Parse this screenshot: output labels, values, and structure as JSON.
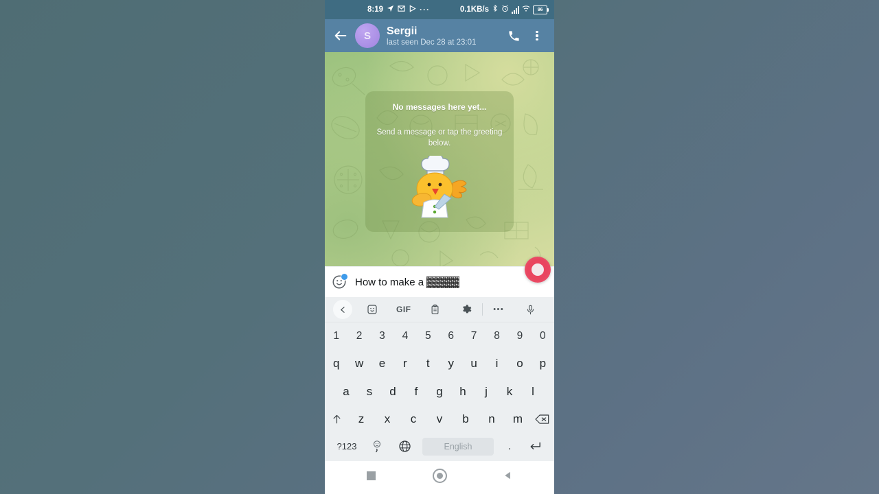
{
  "status_bar": {
    "time": "8:19",
    "icons_left": [
      "location-arrow-icon",
      "mail-icon",
      "play-icon",
      "overflow-dots-icon"
    ],
    "network_speed": "0.1KB/s",
    "icons_right": [
      "bluetooth-icon",
      "alarm-icon",
      "signal-icon",
      "wifi-icon"
    ],
    "battery_level": "96",
    "bg_color": "#3f6c82"
  },
  "app_bar": {
    "back_icon": "back-arrow-icon",
    "avatar_initial": "S",
    "title": "Sergii",
    "subtitle": "last seen Dec 28 at 23:01",
    "call_icon": "phone-icon",
    "menu_icon": "vertical-dots-icon",
    "bg_color": "#5682a3"
  },
  "chat": {
    "greeting_card": {
      "title": "No messages here yet...",
      "subtitle": "Send a message or tap the greeting below.",
      "sticker_name": "chef-chick-sticker"
    },
    "wallpaper": "green-doodle-pattern"
  },
  "input_bar": {
    "sticker_icon": "sticker-smiley-icon",
    "has_badge": true,
    "message_text": "How to make a",
    "redacted_word": true,
    "send_button_icon": "send-record-button",
    "send_button_color": "#ef3e5e"
  },
  "keyboard": {
    "toolbar": [
      {
        "name": "kb-back-chevron",
        "label": "‹"
      },
      {
        "name": "kb-sticker-icon",
        "label": ""
      },
      {
        "name": "kb-gif-button",
        "label": "GIF"
      },
      {
        "name": "kb-clipboard-icon",
        "label": ""
      },
      {
        "name": "kb-settings-gear-icon",
        "label": ""
      },
      {
        "name": "kb-overflow-dots",
        "label": "•••"
      },
      {
        "name": "kb-microphone-icon",
        "label": ""
      }
    ],
    "row_numbers": [
      "1",
      "2",
      "3",
      "4",
      "5",
      "6",
      "7",
      "8",
      "9",
      "0"
    ],
    "row_top": [
      "q",
      "w",
      "e",
      "r",
      "t",
      "y",
      "u",
      "i",
      "o",
      "p"
    ],
    "row_home": [
      "a",
      "s",
      "d",
      "f",
      "g",
      "h",
      "j",
      "k",
      "l"
    ],
    "row_bottom_letters": [
      "z",
      "x",
      "c",
      "v",
      "b",
      "n",
      "m"
    ],
    "shift_label": "↑",
    "backspace_label": "⌫",
    "symbols_key": "?123",
    "comma_key": ",",
    "globe_key": "globe-icon",
    "space_key_label": "English",
    "period_key": ".",
    "enter_key": "↵"
  },
  "nav_bar": {
    "recents": "recents-square-icon",
    "home": "home-circle-icon",
    "back": "back-triangle-icon"
  }
}
